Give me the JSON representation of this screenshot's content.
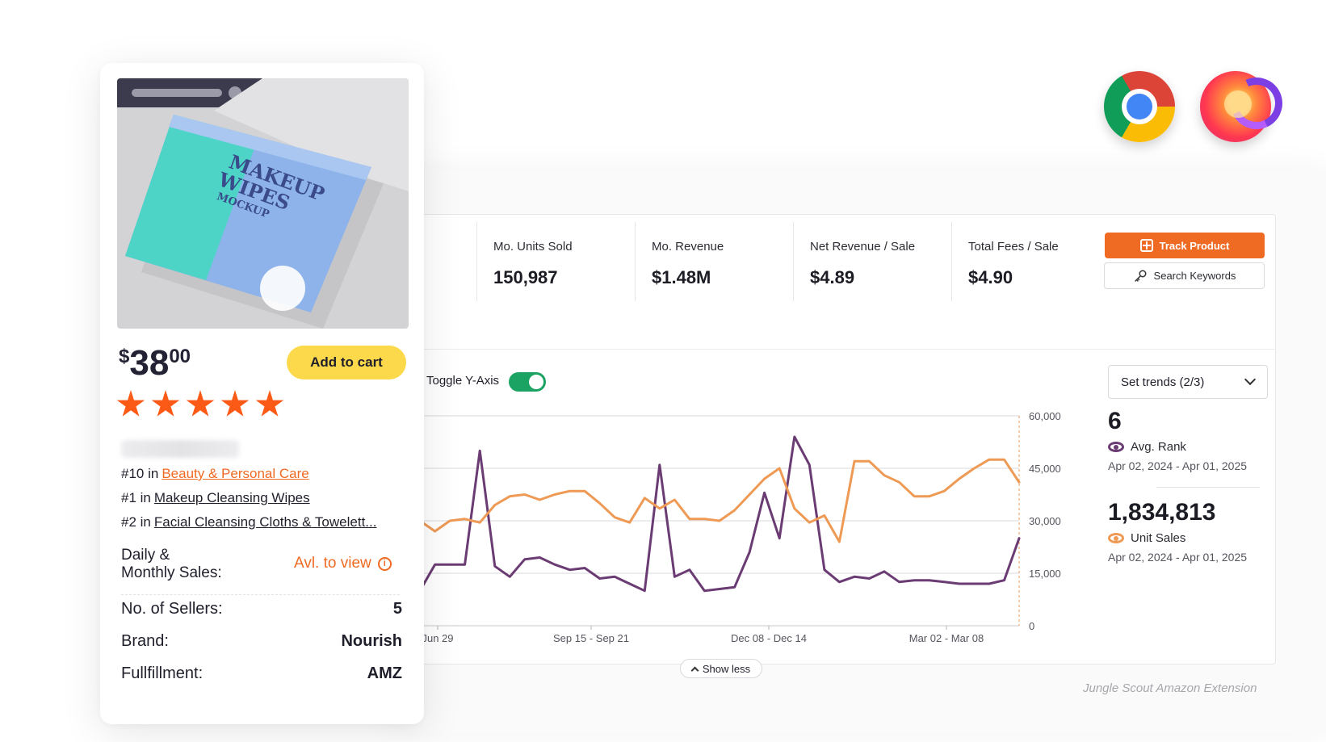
{
  "product": {
    "price_currency": "$",
    "price_whole": "38",
    "price_cents": "00",
    "add_to_cart_label": "Add to cart",
    "rating_stars": 5,
    "rankings": [
      {
        "rank": "#10 in",
        "category": "Beauty & Personal Care"
      },
      {
        "rank": "#1 in",
        "category": "Makeup Cleansing Wipes"
      },
      {
        "rank": "#2 in",
        "category": "Facial Cleansing Cloths & Towelett..."
      }
    ],
    "sales_label_line1": "Daily &",
    "sales_label_line2": "Monthly Sales:",
    "sales_value": "Avl. to view",
    "sellers_label": "No. of Sellers:",
    "sellers_value": "5",
    "brand_label": "Brand:",
    "brand_value": "Nourish",
    "fulfillment_label": "Fullfillment:",
    "fulfillment_value": "AMZ",
    "image_text_line1": "MAKEUP",
    "image_text_line2": "WIPES",
    "image_text_line3": "MOCKUP"
  },
  "stats": [
    {
      "label": "Mo. Units Sold",
      "value": "150,987"
    },
    {
      "label": "Mo. Revenue",
      "value": "$1.48M"
    },
    {
      "label": "Net Revenue / Sale",
      "value": "$4.89"
    },
    {
      "label": "Total Fees / Sale",
      "value": "$4.90"
    }
  ],
  "actions": {
    "track_product": "Track Product",
    "search_keywords": "Search Keywords"
  },
  "toggle_label": "Toggle Y-Axis",
  "toggle_on": true,
  "trends_dropdown": "Set trends (2/3)",
  "metrics": {
    "avg_rank_value": "6",
    "avg_rank_label": "Avg. Rank",
    "avg_rank_range": "Apr 02, 2024 - Apr 01, 2025",
    "unit_sales_value": "1,834,813",
    "unit_sales_label": "Unit Sales",
    "unit_sales_range": "Apr 02, 2024 - Apr 01, 2025"
  },
  "show_less": "Show less",
  "caption": "Jungle Scout Amazon Extension",
  "colors": {
    "accent_orange": "#ef6a23",
    "rank_purple": "#6b3c73",
    "sales_orange": "#ee9a55",
    "toggle_green": "#1aa362",
    "star_orange": "#fb5a16",
    "cart_yellow": "#fcd94a"
  },
  "chart_data": {
    "type": "line",
    "x_tick_labels": [
      "Jun 29",
      "Sep 15 - Sep 21",
      "Dec 08 - Dec 14",
      "Mar 02 - Mar 08"
    ],
    "y_right_ticks": [
      "0",
      "15,000",
      "30,000",
      "45,000",
      "60,000"
    ],
    "ylim": [
      0,
      60000
    ],
    "grid": true,
    "series": [
      {
        "name": "Avg. Rank",
        "color": "#6b3c73",
        "values": [
          10000,
          17500,
          17500,
          17500,
          50000,
          17000,
          14000,
          19000,
          19500,
          17500,
          16000,
          16500,
          13500,
          14000,
          12000,
          10000,
          46000,
          14000,
          16000,
          10000,
          10500,
          11000,
          21000,
          38000,
          25000,
          54000,
          46000,
          16000,
          12500,
          14000,
          13500,
          15500,
          12500,
          13000,
          13000,
          12500,
          12000,
          12000,
          12000,
          13000,
          25000
        ]
      },
      {
        "name": "Unit Sales",
        "color": "#ee9a55",
        "values": [
          30000,
          27000,
          30000,
          30500,
          29500,
          34500,
          37000,
          37500,
          36000,
          37500,
          38500,
          38500,
          35000,
          31000,
          29500,
          36500,
          33500,
          36000,
          30500,
          30500,
          30000,
          33000,
          37500,
          42000,
          45000,
          33500,
          29500,
          31500,
          24000,
          47000,
          47000,
          43000,
          41000,
          37000,
          37000,
          38500,
          42000,
          45000,
          47500,
          47500,
          41000
        ]
      }
    ]
  }
}
